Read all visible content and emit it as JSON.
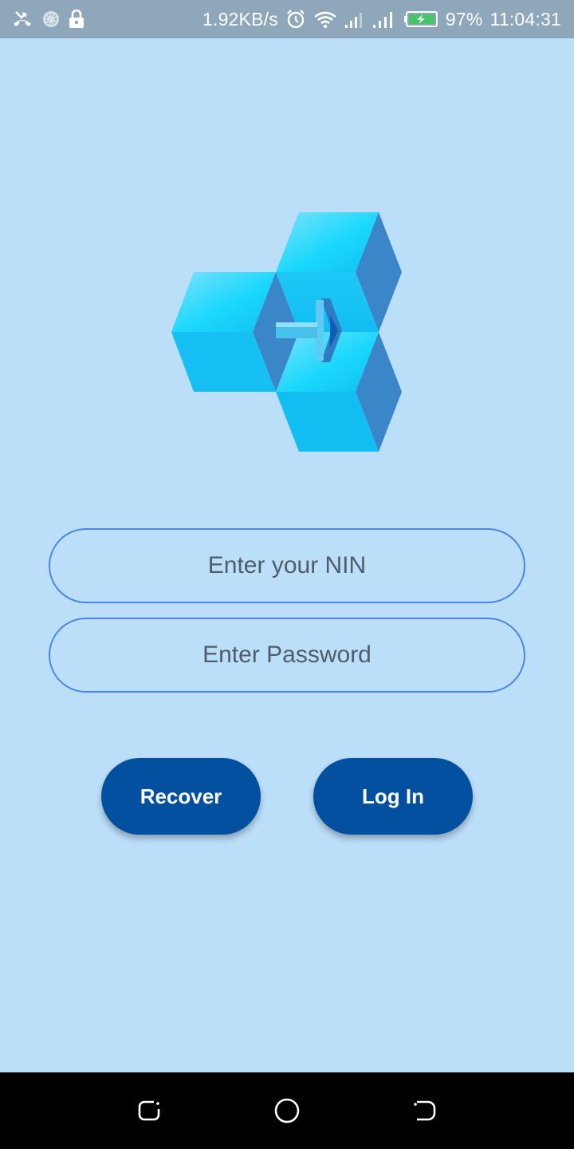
{
  "status_bar": {
    "net_speed": "1.92KB/s",
    "battery_pct": "97%",
    "time": "11:04:31",
    "icons": [
      "missed-call-icon",
      "loading-icon",
      "lock-icon",
      "alarm-icon",
      "wifi-icon",
      "signal-icon",
      "signal-icon",
      "battery-charging-icon"
    ]
  },
  "login": {
    "nin_placeholder": "Enter your NIN",
    "password_placeholder": "Enter Password",
    "recover_label": "Recover",
    "login_label": "Log In"
  },
  "nav_bar": {
    "icons": [
      "recents-icon",
      "home-icon",
      "back-icon"
    ]
  },
  "colors": {
    "background": "#bbdef9",
    "status_bar": "#8ea7bb",
    "field_border": "#4a86e8",
    "button": "#0450a0",
    "logo_cyan": "#16c6f5",
    "logo_blue": "#3b85c9"
  }
}
